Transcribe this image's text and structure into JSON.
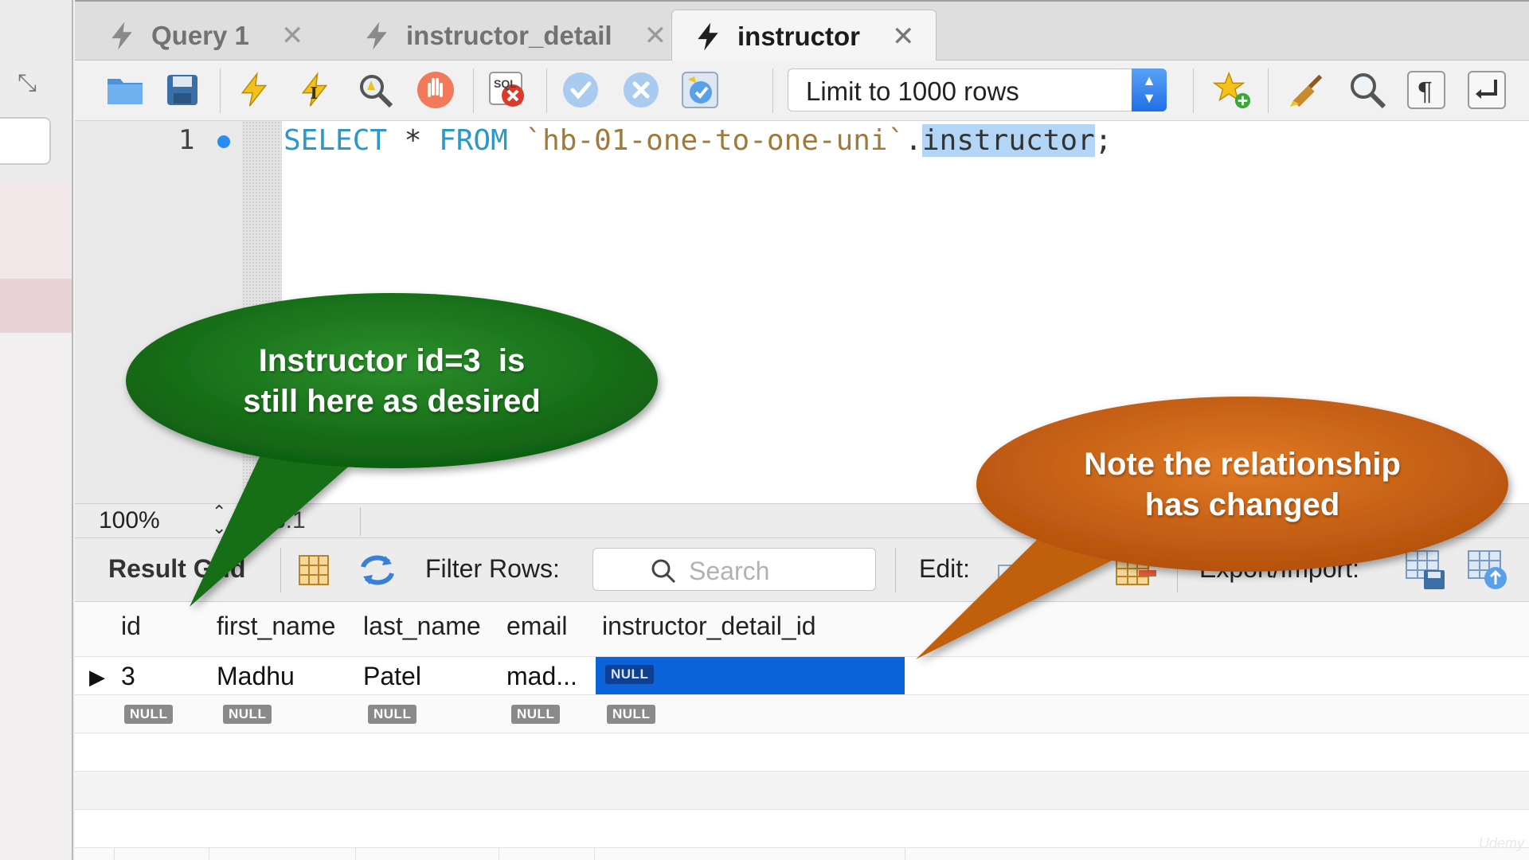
{
  "tabs": [
    {
      "label": "Query 1",
      "active": false
    },
    {
      "label": "instructor_detail",
      "active": false
    },
    {
      "label": "instructor",
      "active": true
    }
  ],
  "toolbar": {
    "icons": [
      "open-folder-icon",
      "save-icon",
      "execute-icon",
      "execute-selection-icon",
      "explain-icon",
      "stop-icon",
      "toggle-error-icon",
      "commit-icon",
      "rollback-icon",
      "autocommit-icon",
      "add-snippet-icon",
      "beautify-icon",
      "find-icon",
      "invisibles-icon",
      "wrap-icon"
    ],
    "limit_rows": "Limit to 1000 rows"
  },
  "editor": {
    "line_number": "1",
    "sql": {
      "kw1": "SELECT",
      "star": " * ",
      "kw2": "FROM",
      "schema": " `hb-01-one-to-one-uni`",
      "dot": ".",
      "table": "instructor",
      "end": ";"
    }
  },
  "status": {
    "zoom": "100%",
    "cursor_pos": "8:1"
  },
  "result_bar": {
    "result_grid_label": "Result Grid",
    "filter_rows_label": "Filter Rows:",
    "search_placeholder": "Search",
    "edit_label": "Edit:",
    "export_import_label": "Export/Import:"
  },
  "grid": {
    "columns": [
      "id",
      "first_name",
      "last_name",
      "email",
      "instructor_detail_id"
    ],
    "rows": [
      [
        "3",
        "Madhu",
        "Patel",
        "mad...",
        "NULL"
      ],
      [
        "NULL",
        "NULL",
        "NULL",
        "NULL",
        "NULL"
      ]
    ]
  },
  "callouts": {
    "green": {
      "line1": "Instructor id=3  is",
      "line2": "still here as desired",
      "color": "#1f7a1f"
    },
    "orange": {
      "line1": "Note the relationship",
      "line2": "has changed",
      "color": "#d2691e"
    }
  },
  "watermark": "Udemy"
}
